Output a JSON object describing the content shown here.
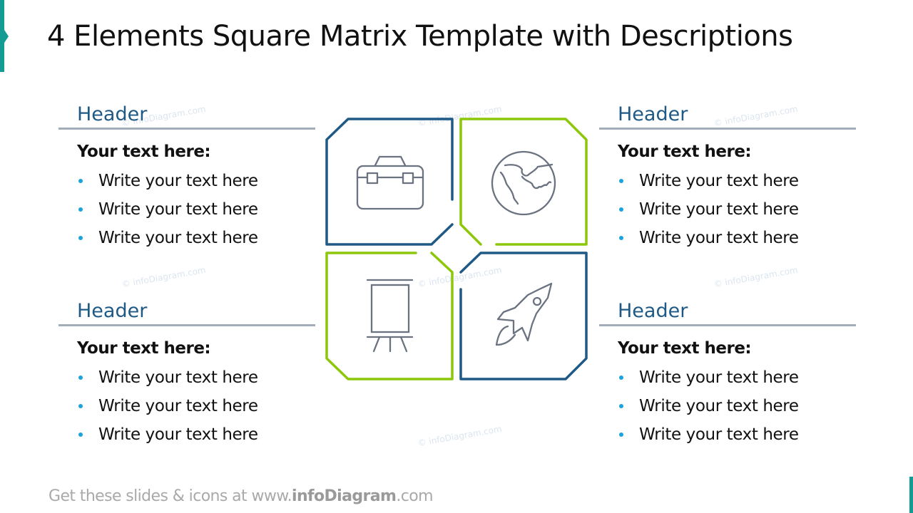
{
  "slide": {
    "title": "4 Elements Square Matrix Template with Descriptions",
    "footer": {
      "prefix": "Get these slides & icons at www.",
      "brand": "infoDiagram",
      "suffix": ".com"
    },
    "watermark": "© infoDiagram.com",
    "colors": {
      "navy": "#1f5a86",
      "green": "#8cc70a",
      "teal": "#149b93",
      "icon": "#6b7280",
      "bullet": "#1aa3dd",
      "rule": "#a3adba"
    }
  },
  "panels": [
    {
      "header": "Header",
      "subtitle": "Your text here:",
      "bullets": [
        "Write your text here",
        "Write your text here",
        "Write your text here"
      ]
    },
    {
      "header": "Header",
      "subtitle": "Your text here:",
      "bullets": [
        "Write your text here",
        "Write your text here",
        "Write your text here"
      ]
    },
    {
      "header": "Header",
      "subtitle": "Your text here:",
      "bullets": [
        "Write your text here",
        "Write your text here",
        "Write your text here"
      ]
    },
    {
      "header": "Header",
      "subtitle": "Your text here:",
      "bullets": [
        "Write your text here",
        "Write your text here",
        "Write your text here"
      ]
    }
  ],
  "matrix": {
    "quadrants": [
      {
        "position": "top-left",
        "color": "navy",
        "icon": "toolbox-icon"
      },
      {
        "position": "top-right",
        "color": "green",
        "icon": "globe-icon"
      },
      {
        "position": "bottom-left",
        "color": "green",
        "icon": "flipchart-icon"
      },
      {
        "position": "bottom-right",
        "color": "navy",
        "icon": "rocket-icon"
      }
    ]
  }
}
